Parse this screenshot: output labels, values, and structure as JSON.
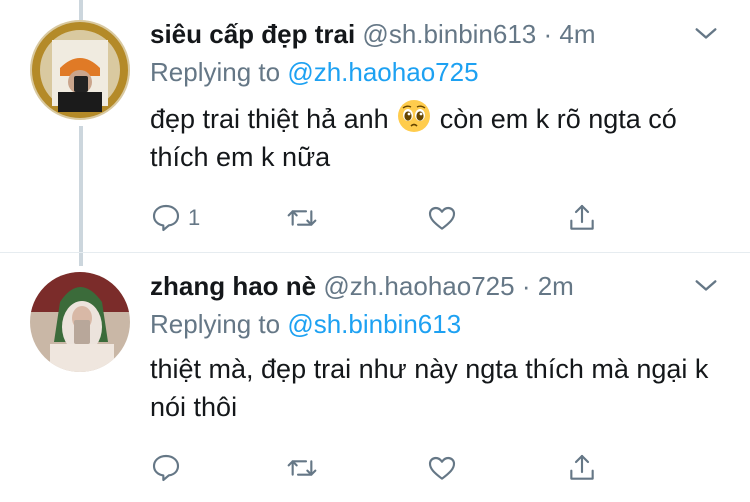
{
  "tweets": [
    {
      "name": "siêu cấp đẹp trai",
      "handle": "@sh.binbin613",
      "dot": "·",
      "time": "4m",
      "replying_prefix": "Replying to",
      "replying_to": "@zh.haohao725",
      "text_before_emoji": "đẹp trai thiệt hả anh ",
      "emoji": "pleading-face-emoji",
      "text_after_emoji": " còn em k rõ ngta có thích em k nữa",
      "reply_count": "1"
    },
    {
      "name": "zhang hao nè",
      "handle": "@zh.haohao725",
      "dot": "·",
      "time": "2m",
      "replying_prefix": "Replying to",
      "replying_to": "@sh.binbin613",
      "text": "thiệt mà, đẹp trai như này ngta thích mà ngại k nói thôi",
      "reply_count": ""
    }
  ],
  "colors": {
    "link": "#1da1f2",
    "secondary_text": "#657786",
    "thread_line": "#ccd6dd"
  }
}
